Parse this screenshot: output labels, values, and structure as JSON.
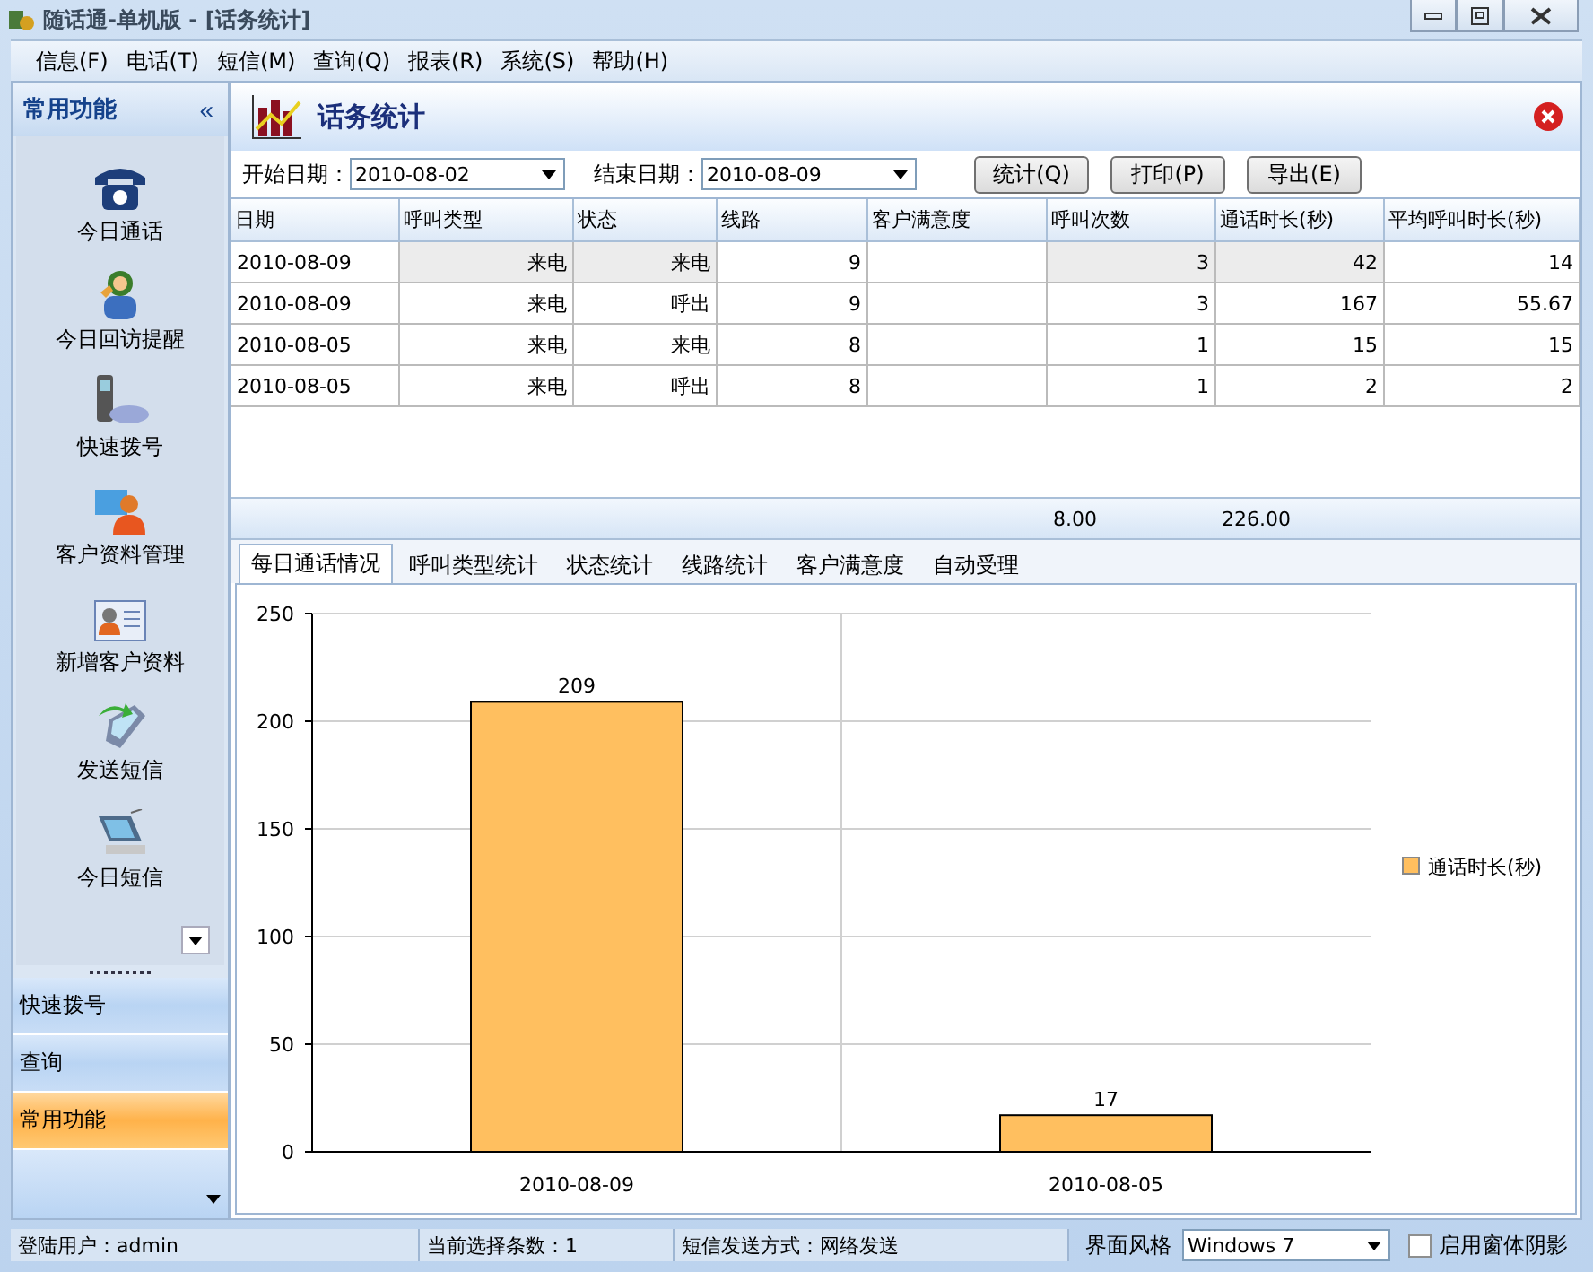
{
  "window": {
    "title": "随话通-单机版 - [话务统计]"
  },
  "menu": [
    {
      "label": "信息(F)"
    },
    {
      "label": "电话(T)"
    },
    {
      "label": "短信(M)"
    },
    {
      "label": "查询(Q)"
    },
    {
      "label": "报表(R)"
    },
    {
      "label": "系统(S)"
    },
    {
      "label": "帮助(H)"
    }
  ],
  "sidebar": {
    "title": "常用功能",
    "collapse": "«",
    "items": [
      {
        "label": "今日通话"
      },
      {
        "label": "今日回访提醒"
      },
      {
        "label": "快速拨号"
      },
      {
        "label": "客户资料管理"
      },
      {
        "label": "新增客户资料"
      },
      {
        "label": "发送短信"
      },
      {
        "label": "今日短信"
      }
    ],
    "groups": [
      {
        "label": "快速拨号",
        "selected": false
      },
      {
        "label": "查询",
        "selected": false
      },
      {
        "label": "常用功能",
        "selected": true
      }
    ]
  },
  "page": {
    "title": "话务统计"
  },
  "filters": [
    {
      "label": "开始日期：",
      "value": "2010-08-02"
    },
    {
      "label": "结束日期：",
      "value": "2010-08-09"
    }
  ],
  "buttons": [
    {
      "label": "统计(Q)"
    },
    {
      "label": "打印(P)"
    },
    {
      "label": "导出(E)"
    }
  ],
  "table": {
    "columns": [
      "日期",
      "呼叫类型",
      "状态",
      "线路",
      "客户满意度",
      "呼叫次数",
      "通话时长(秒)",
      "平均呼叫时长(秒)"
    ],
    "rows": [
      {
        "selected": true,
        "cells": [
          "2010-08-09",
          "来电",
          "来电",
          "9",
          "",
          "3",
          "42",
          "14"
        ]
      },
      {
        "selected": false,
        "cells": [
          "2010-08-09",
          "来电",
          "呼出",
          "9",
          "",
          "3",
          "167",
          "55.67"
        ]
      },
      {
        "selected": false,
        "cells": [
          "2010-08-05",
          "来电",
          "来电",
          "8",
          "",
          "1",
          "15",
          "15"
        ]
      },
      {
        "selected": false,
        "cells": [
          "2010-08-05",
          "来电",
          "呼出",
          "8",
          "",
          "1",
          "2",
          "2"
        ]
      }
    ],
    "summary": {
      "call_count": "8.00",
      "duration": "226.00"
    }
  },
  "chart_tabs": [
    {
      "label": "每日通话情况",
      "selected": true
    },
    {
      "label": "呼叫类型统计",
      "selected": false
    },
    {
      "label": "状态统计",
      "selected": false
    },
    {
      "label": "线路统计",
      "selected": false
    },
    {
      "label": "客户满意度",
      "selected": false
    },
    {
      "label": "自动受理",
      "selected": false
    }
  ],
  "chart_data": {
    "type": "bar",
    "categories": [
      "2010-08-09",
      "2010-08-05"
    ],
    "series": [
      {
        "name": "通话时长(秒)",
        "color": "#ffbf5f",
        "values": [
          209,
          17
        ]
      }
    ],
    "ylim": [
      0,
      250
    ],
    "yticks": [
      0,
      50,
      100,
      150,
      200,
      250
    ],
    "data_labels": true,
    "grid": true
  },
  "status_bar": {
    "user": "登陆用户：admin",
    "selected_count": "当前选择条数：1",
    "sms_mode": "短信发送方式：网络发送",
    "theme_label": "界面风格",
    "theme": "Windows 7",
    "shadow_label": "启用窗体阴影",
    "shadow": false
  }
}
